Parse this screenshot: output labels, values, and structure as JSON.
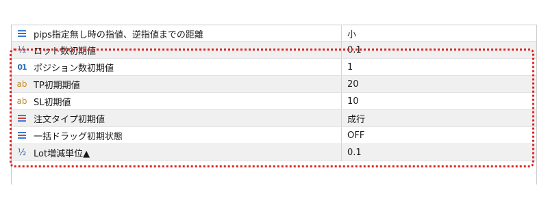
{
  "params": [
    {
      "icon": "enum-icon",
      "name": "pips指定無し時の指値、逆指値までの距離",
      "value": "小"
    },
    {
      "icon": "fraction-icon",
      "name": "ロット数初期値",
      "value": "0.1"
    },
    {
      "icon": "integer-icon",
      "name": "ポジション数初期値",
      "value": "1"
    },
    {
      "icon": "string-icon",
      "name": "TP初期期値",
      "value": "20"
    },
    {
      "icon": "string-icon",
      "name": "SL初期値",
      "value": "10"
    },
    {
      "icon": "enum-icon",
      "name": "注文タイプ初期値",
      "value": "成行"
    },
    {
      "icon": "enum-icon",
      "name": "一括ドラッグ初期状態",
      "value": "OFF"
    },
    {
      "icon": "fraction-icon",
      "name": "Lot増減単位▲",
      "value": "0.1"
    }
  ],
  "icons": {
    "frac": "½",
    "int": "01",
    "str": "ab"
  },
  "highlight_color": "#e02020",
  "enum_icon_colors": [
    "#3a7bd5",
    "#d04040"
  ]
}
